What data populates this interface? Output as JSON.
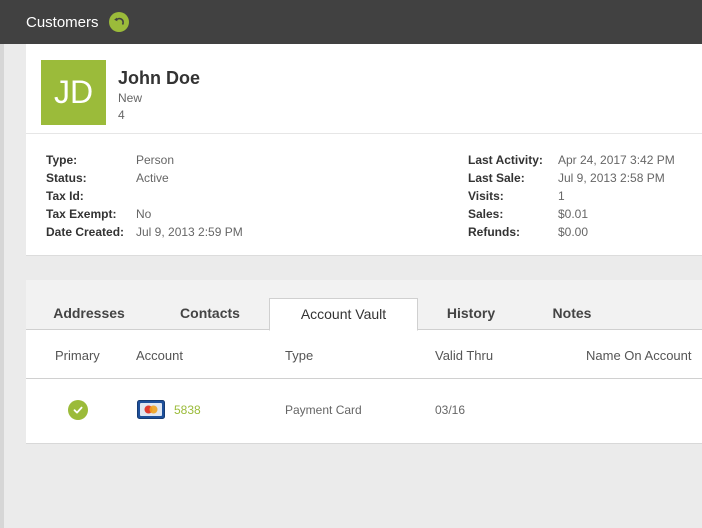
{
  "header": {
    "title": "Customers",
    "back_icon": "back-arrow-icon",
    "accent": "#9bbb3a"
  },
  "customer": {
    "initials": "JD",
    "name": "John Doe",
    "status_line": "New",
    "number_line": "4",
    "left_details": [
      {
        "label": "Type:",
        "value": "Person"
      },
      {
        "label": "Status:",
        "value": "Active"
      },
      {
        "label": "Tax Id:",
        "value": ""
      },
      {
        "label": "Tax Exempt:",
        "value": "No"
      },
      {
        "label": "Date Created:",
        "value": "Jul 9, 2013 2:59 PM"
      }
    ],
    "right_details": [
      {
        "label": "Last Activity:",
        "value": "Apr 24, 2017 3:42 PM"
      },
      {
        "label": "Last Sale:",
        "value": "Jul 9, 2013 2:58 PM"
      },
      {
        "label": "Visits:",
        "value": "1"
      },
      {
        "label": "Sales:",
        "value": "$0.01"
      },
      {
        "label": "Refunds:",
        "value": "$0.00"
      }
    ]
  },
  "tabs": [
    {
      "label": "Addresses",
      "active": false
    },
    {
      "label": "Contacts",
      "active": false
    },
    {
      "label": "Account Vault",
      "active": true
    },
    {
      "label": "History",
      "active": false
    },
    {
      "label": "Notes",
      "active": false
    }
  ],
  "vault_table": {
    "columns": [
      "Primary",
      "Account",
      "Type",
      "Valid Thru",
      "Name On Account"
    ],
    "rows": [
      {
        "primary_icon": "check-circle-icon",
        "card_icon": "credit-card-icon",
        "account": "5838",
        "type": "Payment Card",
        "valid_thru": "03/16",
        "name_on_account": ""
      }
    ]
  }
}
